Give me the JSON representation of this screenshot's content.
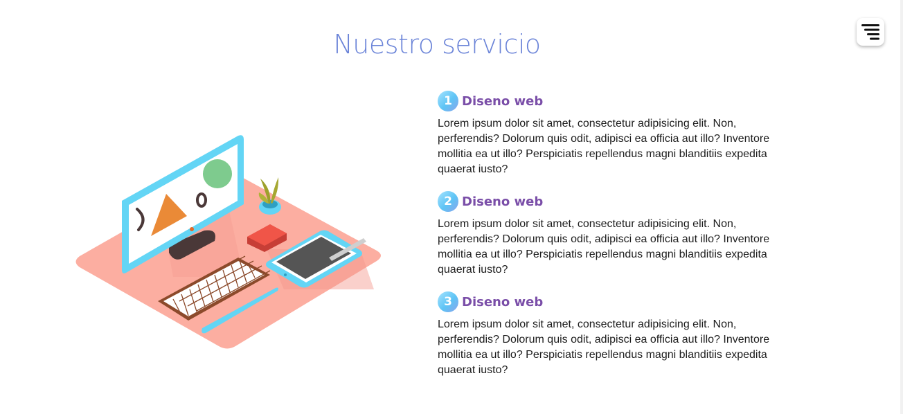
{
  "section": {
    "title": "Nuestro servicio"
  },
  "menu": {
    "icon": "hamburger-menu-icon"
  },
  "services": [
    {
      "number": "1",
      "title": "Diseno web",
      "text": "Lorem ipsum dolor sit amet, consectetur adipisicing elit. Non, perferendis? Dolorum quis odit, adipisci ea officia aut illo? Inventore mollitia ea ut illo? Perspiciatis repellendus magni blanditiis expedita quaerat iusto?"
    },
    {
      "number": "2",
      "title": "Diseno web",
      "text": "Lorem ipsum dolor sit amet, consectetur adipisicing elit. Non, perferendis? Dolorum quis odit, adipisci ea officia aut illo? Inventore mollitia ea ut illo? Perspiciatis repellendus magni blanditiis expedita quaerat iusto?"
    },
    {
      "number": "3",
      "title": "Diseno web",
      "text": "Lorem ipsum dolor sit amet, consectetur adipisicing elit. Non, perferendis? Dolorum quis odit, adipisci ea officia aut illo? Inventore mollitia ea ut illo? Perspiciatis repellendus magni blanditiis expedita quaerat iusto?"
    }
  ],
  "colors": {
    "title": "#6b84d8",
    "service_title": "#7a4ea8",
    "badge_start": "#a6e3ff",
    "badge_end": "#8ba3ec",
    "desk": "#fcaea1",
    "monitor_frame": "#63d5f5"
  }
}
